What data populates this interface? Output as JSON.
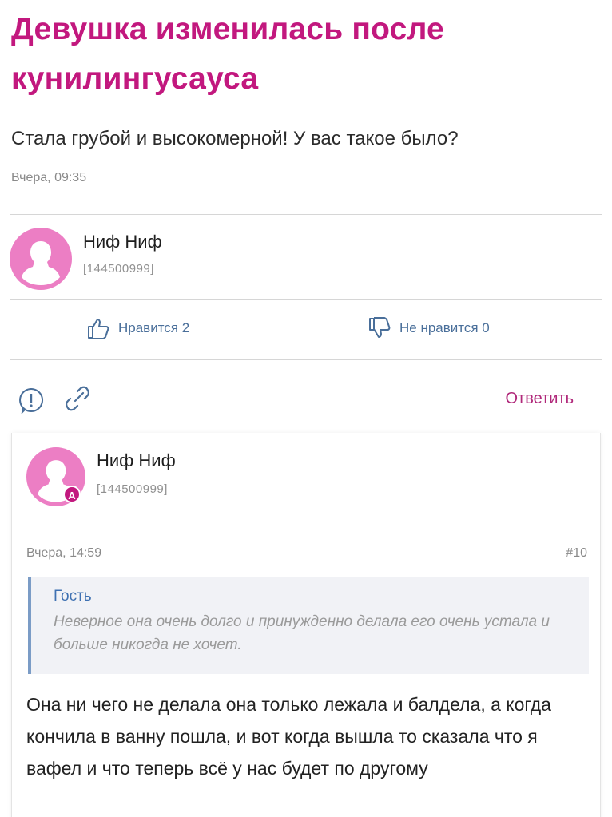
{
  "post": {
    "title": "Девушка изменилась после кунилингусауса",
    "subtitle": "Стала грубой и высокомерной! У вас такое было?",
    "time": "Вчера, 09:35",
    "author": {
      "name": "Ниф Ниф",
      "id": "[144500999]"
    },
    "likes_label": "Нравится 2",
    "dislikes_label": "Не нравится 0",
    "reply_label": "Ответить"
  },
  "reply": {
    "author": {
      "name": "Ниф Ниф",
      "id": "[144500999]",
      "badge": "A"
    },
    "time": "Вчера, 14:59",
    "number": "#10",
    "quote": {
      "author": "Гость",
      "text": "Неверное она очень долго и принужденно делала его очень устала и больше никогда не хочет."
    },
    "text": "Она ни чего не делала она только лежала и балдела, а когда кончила в ванну пошла, и вот когда вышла то сказала что я вафел и что теперь всё у нас будет по другому"
  },
  "colors": {
    "accent": "#c2187e",
    "avatar": "#ec7ec4",
    "link": "#4a6f9a",
    "quote_author": "#3f71b2"
  },
  "icons": [
    "user-avatar-icon",
    "thumbs-up-icon",
    "thumbs-down-icon",
    "report-icon",
    "link-icon"
  ]
}
